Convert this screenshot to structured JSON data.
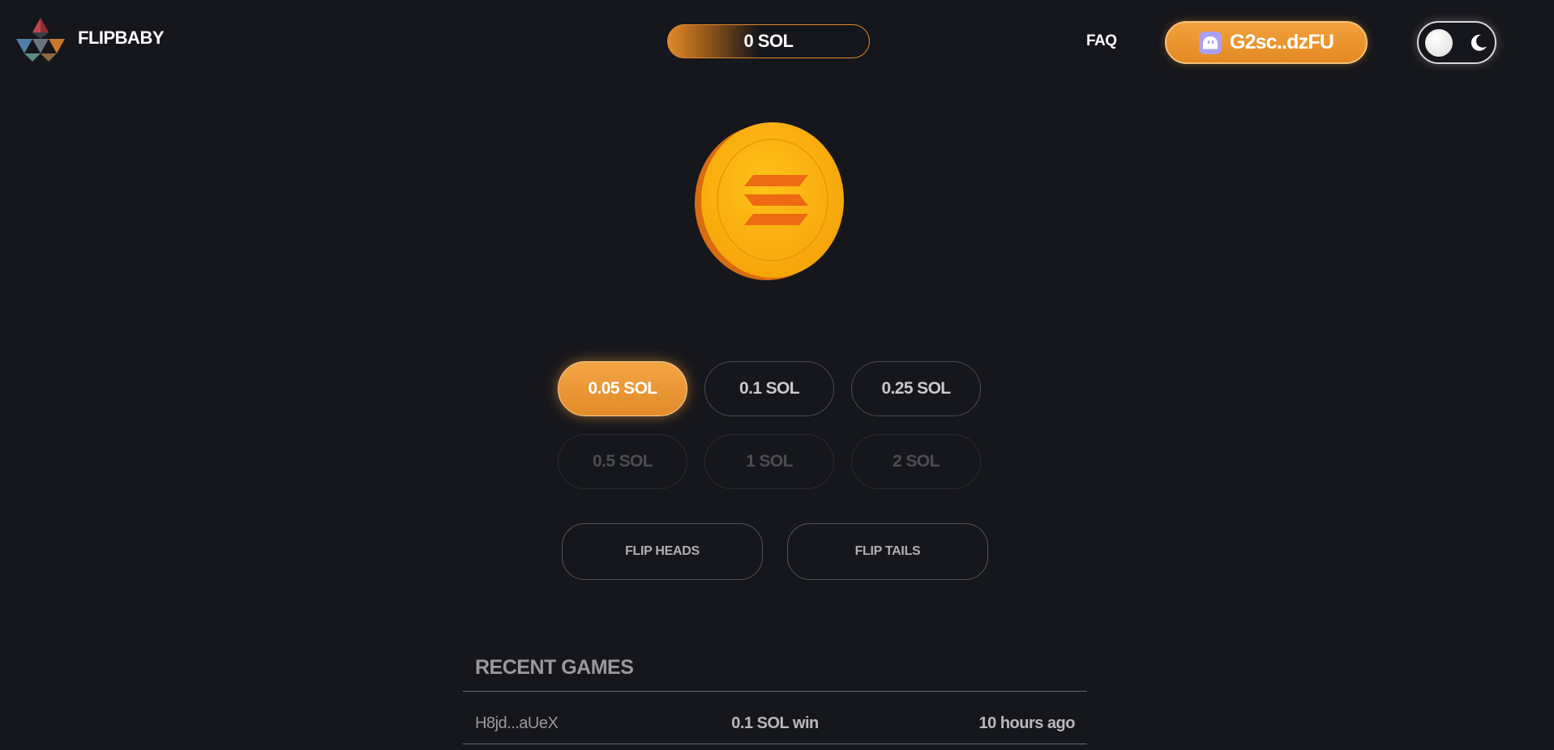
{
  "header": {
    "brand": "FLIPBABY",
    "balance": "0 SOL",
    "faq_label": "FAQ",
    "wallet_label": "G2sc..dzFU"
  },
  "bets": {
    "row1": [
      "0.05 SOL",
      "0.1 SOL",
      "0.25 SOL"
    ],
    "row2": [
      "0.5 SOL",
      "1 SOL",
      "2 SOL"
    ],
    "selected": "0.05 SOL"
  },
  "actions": {
    "flip_heads": "FLIP HEADS",
    "flip_tails": "FLIP TAILS"
  },
  "recent_games": {
    "title": "RECENT GAMES",
    "rows": [
      {
        "player": "H8jd...aUeX",
        "result": "0.1 SOL win",
        "time": "10 hours ago"
      }
    ]
  },
  "icons": {
    "logo": "flipbaby-logo",
    "wallet": "phantom-ghost-icon",
    "theme_sun": "toggle-knob",
    "theme_moon": "moon-icon",
    "coin": "solana-coin"
  },
  "colors": {
    "accent": "#e8922e",
    "background": "#16171c",
    "phantom": "#ab9ff2"
  }
}
